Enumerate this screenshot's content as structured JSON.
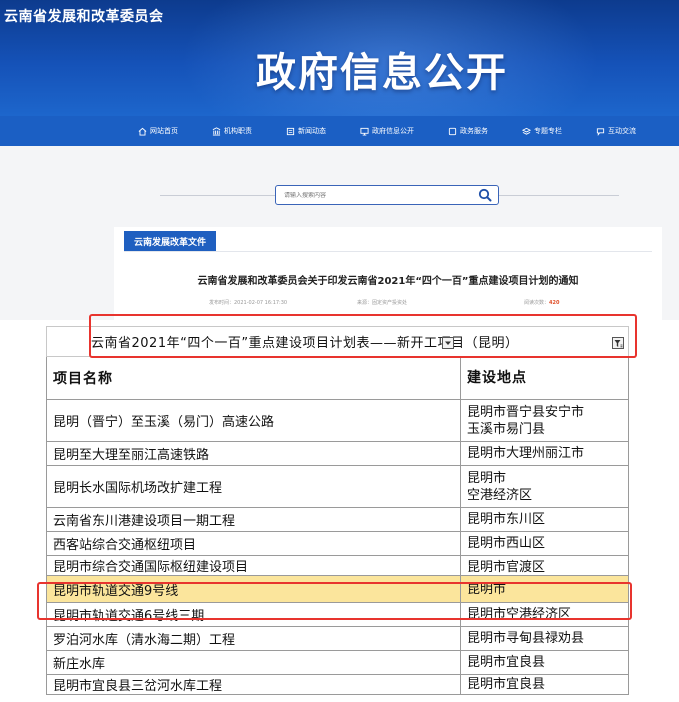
{
  "header": {
    "org_name": "云南省发展和改革委员会",
    "banner_title": "政府信息公开"
  },
  "nav": {
    "items": [
      {
        "label": "网站首页",
        "icon": "home-icon"
      },
      {
        "label": "机构职责",
        "icon": "building-icon"
      },
      {
        "label": "新闻动态",
        "icon": "news-icon"
      },
      {
        "label": "政府信息公开",
        "icon": "monitor-icon"
      },
      {
        "label": "政务服务",
        "icon": "window-icon"
      },
      {
        "label": "专题专栏",
        "icon": "layers-icon"
      },
      {
        "label": "互动交流",
        "icon": "chat-icon"
      }
    ]
  },
  "search": {
    "placeholder": "请输入搜索内容",
    "icon": "search-icon"
  },
  "article": {
    "category": "云南发展改革文件",
    "title": "云南省发展和改革委员会关于印发云南省2021年“四个一百”重点建设项目计划的通知",
    "date": "发布时间：2021-02-07 16:17:30",
    "source": "来源：固定资产投资处",
    "views_label": "阅读次数：",
    "views": "420"
  },
  "sheet": {
    "title": "云南省2021年“四个一百”重点建设项目计划表——新开工项目（昆明）",
    "headers": [
      "项目名称",
      "建设地点"
    ],
    "rows": [
      {
        "name": "昆明（晋宁）至玉溪（易门）高速公路",
        "place": [
          "昆明市晋宁县安宁市",
          "玉溪市易门县"
        ]
      },
      {
        "name": "昆明至大理至丽江高速铁路",
        "place": [
          "昆明市大理州丽江市"
        ]
      },
      {
        "name": "昆明长水国际机场改扩建工程",
        "place": [
          "昆明市",
          "空港经济区"
        ]
      },
      {
        "name": "云南省东川港建设项目一期工程",
        "place": [
          "昆明市东川区"
        ]
      },
      {
        "name": "西客站综合交通枢纽项目",
        "place": [
          "昆明市西山区"
        ]
      },
      {
        "name": "昆明市综合交通国际枢纽建设项目",
        "place": [
          "昆明市官渡区"
        ]
      },
      {
        "name": "昆明市轨道交通9号线",
        "place": [
          "昆明市"
        ]
      },
      {
        "name": "昆明市轨道交通6号线三期",
        "place": [
          "昆明市空港经济区"
        ]
      },
      {
        "name": "罗泊河水库（清水海二期）工程",
        "place": [
          "昆明市寻甸县禄劝县"
        ]
      },
      {
        "name": "新庄水库",
        "place": [
          "昆明市宜良县"
        ]
      },
      {
        "name": "昆明市宜良县三岔河水库工程",
        "place": [
          "昆明市宜良县"
        ]
      }
    ]
  },
  "colors": {
    "banner": "#1552b8",
    "nav": "#1b5fc4",
    "highlight_row": "#fbe59c",
    "annotation": "#e8342e"
  }
}
